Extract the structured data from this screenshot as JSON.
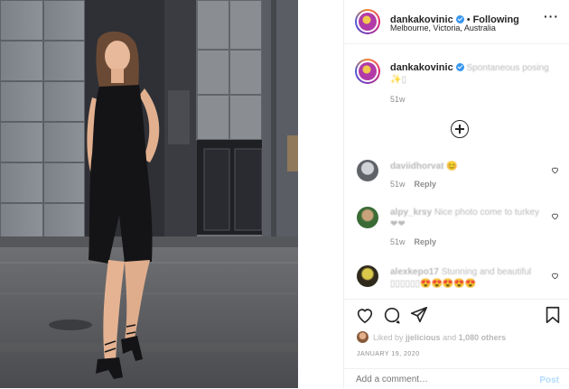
{
  "header": {
    "username": "dankakovinic",
    "separator": "•",
    "follow_label": "Following",
    "location": "Melbourne, Victoria, Australia",
    "more_icon": "more-options-icon"
  },
  "caption": {
    "username": "dankakovinic",
    "text": "Spontaneous posing",
    "emoji_line": "✨▯",
    "time": "51w"
  },
  "comments": [
    {
      "username": "daviidhorvat",
      "text": "😊",
      "time": "51w",
      "reply_label": "Reply"
    },
    {
      "username": "alpy_krsy",
      "text": "Nice photo come to turkey❤❤",
      "time": "51w",
      "reply_label": "Reply"
    },
    {
      "username": "alexkepo17",
      "text": "Stunning and beautiful ▯▯▯▯▯▯😍😍😍😍😍",
      "time": "",
      "reply_label": ""
    }
  ],
  "actions": {
    "like_icon": "heart-icon",
    "comment_icon": "comment-icon",
    "share_icon": "share-icon",
    "save_icon": "bookmark-icon",
    "liked_by_prefix": "Liked by",
    "liked_by_user": "jjelicious",
    "liked_by_and": "and",
    "liked_by_count": "1,080 others",
    "date": "JANUARY 19, 2020"
  },
  "add_comment": {
    "placeholder": "Add a comment…",
    "post_label": "Post"
  },
  "colors": {
    "link_blue": "#3897f0",
    "post_button_disabled": "#b3dbff",
    "verified_blue": "#3897f0"
  }
}
